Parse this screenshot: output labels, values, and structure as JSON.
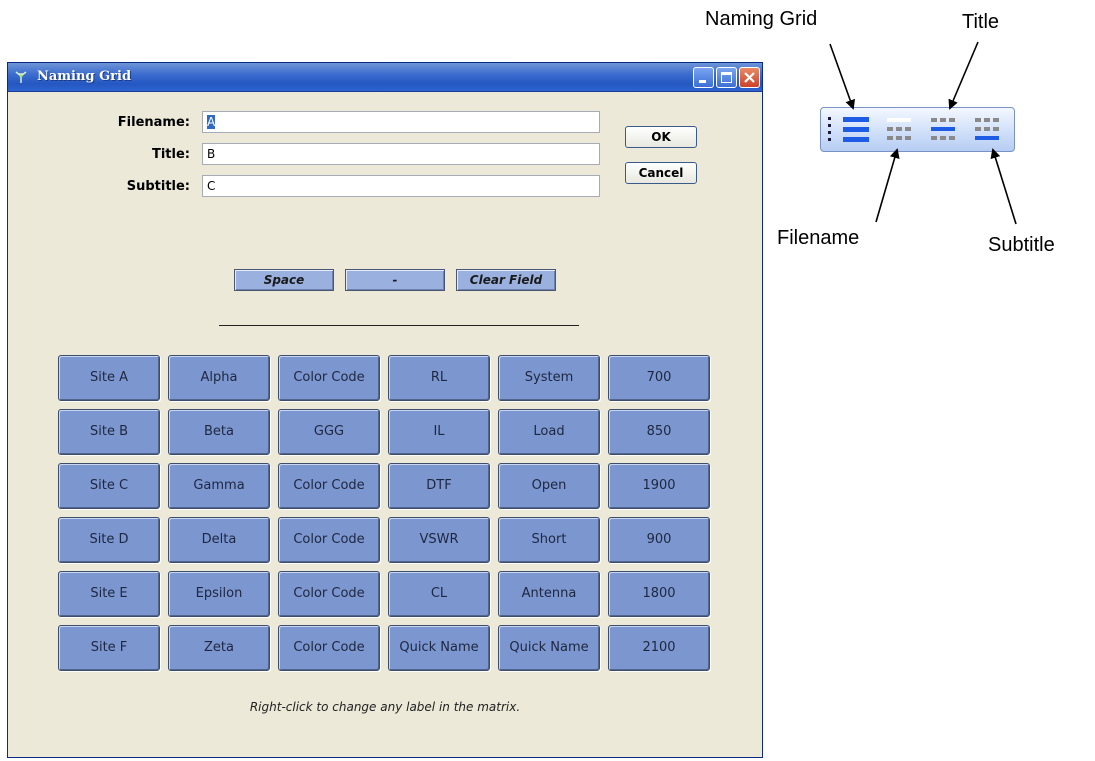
{
  "window": {
    "title": "Naming Grid"
  },
  "form": {
    "filename_label": "Filename:",
    "filename_value": "A",
    "title_label": "Title:",
    "title_value": "B",
    "subtitle_label": "Subtitle:",
    "subtitle_value": "C",
    "ok_label": "OK",
    "cancel_label": "Cancel",
    "space_label": "Space",
    "dash_label": "-",
    "clear_label": "Clear Field"
  },
  "grid": {
    "rows": [
      [
        "Site A",
        "Alpha",
        "Color Code",
        "RL",
        "System",
        "700"
      ],
      [
        "Site B",
        "Beta",
        "GGG",
        "IL",
        "Load",
        "850"
      ],
      [
        "Site C",
        "Gamma",
        "Color Code",
        "DTF",
        "Open",
        "1900"
      ],
      [
        "Site D",
        "Delta",
        "Color Code",
        "VSWR",
        "Short",
        "900"
      ],
      [
        "Site E",
        "Epsilon",
        "Color Code",
        "CL",
        "Antenna",
        "1800"
      ],
      [
        "Site F",
        "Zeta",
        "Color Code",
        "Quick Name",
        "Quick Name",
        "2100"
      ]
    ]
  },
  "hint": "Right-click to change any label in the matrix.",
  "callouts": {
    "naming_grid": "Naming Grid",
    "title": "Title",
    "filename": "Filename",
    "subtitle": "Subtitle"
  },
  "colors": {
    "titlebar": "#2457c2",
    "grid_button": "#7c96cf",
    "toolbar_blue": "#1f5ce6",
    "toolbar_gray": "#8a8a8a"
  }
}
